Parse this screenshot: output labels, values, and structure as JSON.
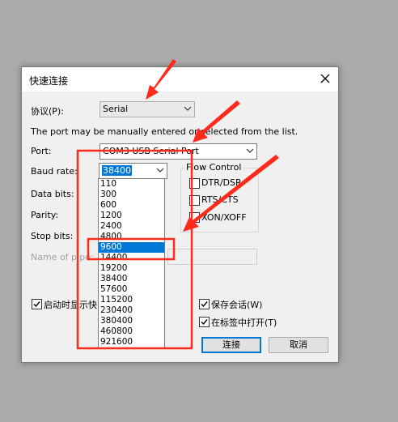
{
  "dialog": {
    "title": "快速连接",
    "protocol": {
      "label": "协议(P):",
      "value": "Serial"
    },
    "hint": "The port may be manually entered or selected from the list.",
    "port": {
      "label": "Port:",
      "value": "COM3 USB Serial Port"
    },
    "baud": {
      "label": "Baud rate:",
      "value": "38400",
      "options": [
        "110",
        "300",
        "600",
        "1200",
        "2400",
        "4800",
        "9600",
        "14400",
        "19200",
        "38400",
        "57600",
        "115200",
        "230400",
        "380400",
        "460800",
        "921600"
      ],
      "highlighted": "9600"
    },
    "data_bits": {
      "label": "Data bits:"
    },
    "parity": {
      "label": "Parity:"
    },
    "stop_bits": {
      "label": "Stop bits:"
    },
    "pipe": {
      "label": "Name of pipe:"
    },
    "flow_control": {
      "title": "Flow Control",
      "dtr": "DTR/DSR",
      "rts": "RTS/CTS",
      "xon": "XON/XOFF"
    },
    "show_on_startup": "启动时显示快",
    "save_session": "保存会话(W)",
    "open_in_tab": "在标签中打开(T)",
    "connect": "连接",
    "cancel": "取消"
  },
  "colors": {
    "annotation": "#ff2a1a",
    "selection": "#0078d7",
    "background": "#ababab"
  }
}
